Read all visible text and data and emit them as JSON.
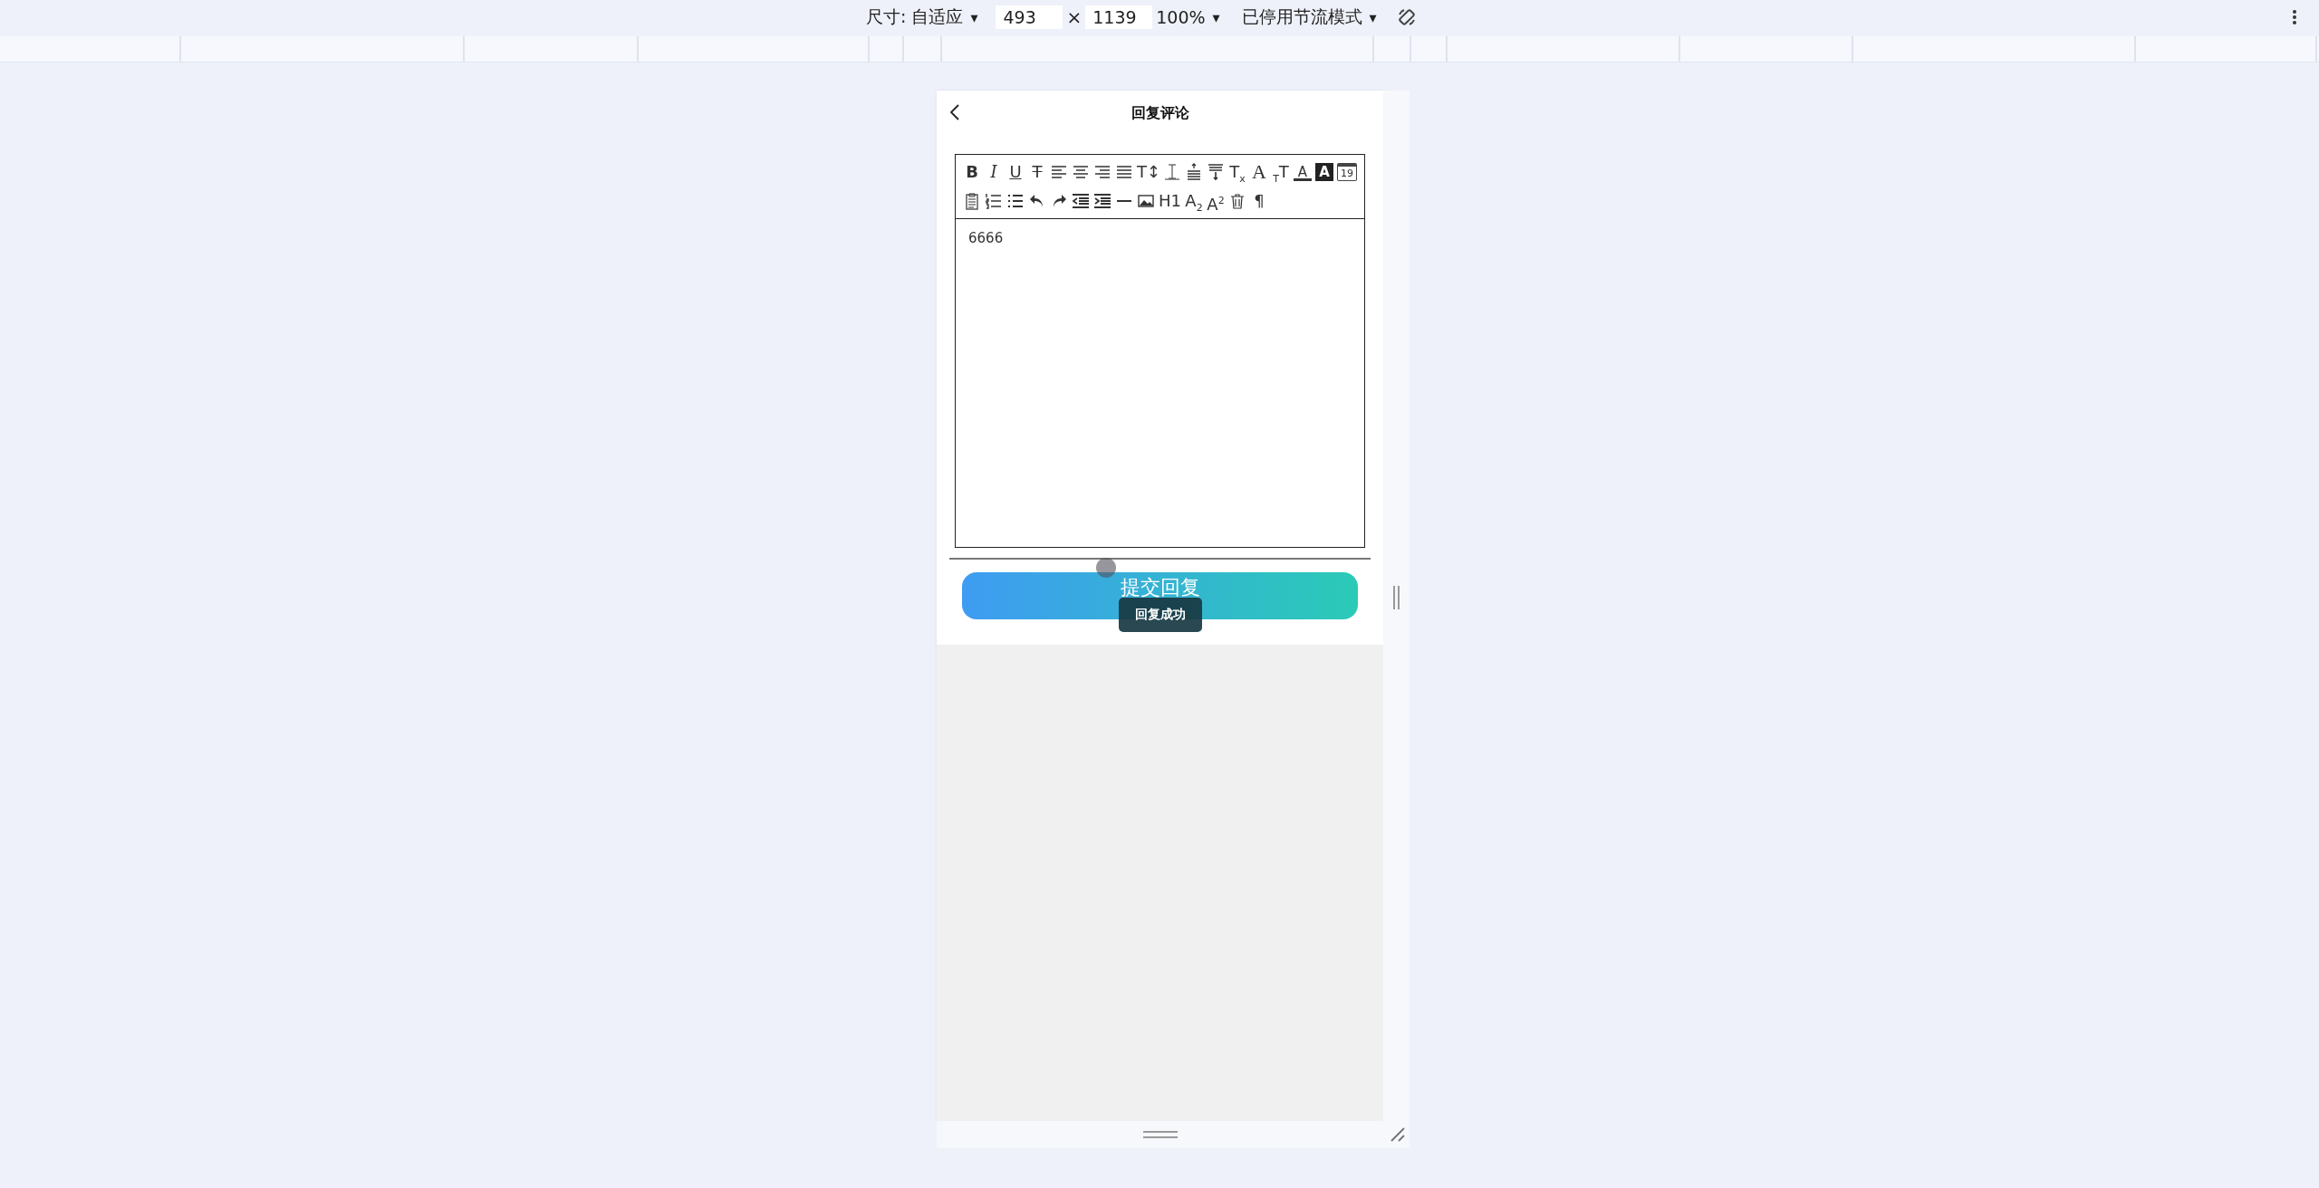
{
  "devtools_bar": {
    "size_label": "尺寸: 自适应",
    "size_caret": "▾",
    "width_value": "493",
    "times": "×",
    "height_value": "1139",
    "zoom": "100%",
    "zoom_caret": "▾",
    "throttling": "已停用节流模式",
    "throttling_caret": "▾"
  },
  "header": {
    "title": "回复评论"
  },
  "editor": {
    "toolbar_rows": [
      [
        {
          "kind": "bold",
          "text": "B"
        },
        {
          "kind": "italic",
          "text": "I"
        },
        {
          "kind": "underline",
          "text": "U"
        },
        {
          "kind": "strike",
          "text": "T"
        },
        {
          "kind": "icon"
        },
        {
          "kind": "icon"
        },
        {
          "kind": "icon"
        },
        {
          "kind": "icon"
        },
        {
          "kind": "plain",
          "text": "T↕"
        },
        {
          "kind": "icon"
        },
        {
          "kind": "icon"
        },
        {
          "kind": "icon"
        },
        {
          "kind": "plain",
          "text": "T$_{x}$"
        },
        {
          "kind": "serif",
          "text": "A"
        },
        {
          "kind": "plain",
          "text": "$_{T}$T"
        },
        {
          "kind": "color",
          "text": "A"
        },
        {
          "kind": "inverse",
          "text": "A"
        },
        {
          "kind": "calendar",
          "text": "19"
        }
      ],
      [
        {
          "kind": "icon"
        },
        {
          "kind": "icon"
        },
        {
          "kind": "icon"
        },
        {
          "kind": "icon"
        },
        {
          "kind": "icon"
        },
        {
          "kind": "icon"
        },
        {
          "kind": "icon"
        },
        {
          "kind": "icon"
        },
        {
          "kind": "icon"
        },
        {
          "kind": "plain",
          "text": "H1"
        },
        {
          "kind": "plain",
          "text": "A$_{2}$"
        },
        {
          "kind": "plain",
          "text": "A$^{2}$"
        },
        {
          "kind": "icon"
        },
        {
          "kind": "plain",
          "text": "¶"
        }
      ]
    ],
    "content": "6666"
  },
  "submit_button": "提交回复",
  "toast": "回复成功"
}
